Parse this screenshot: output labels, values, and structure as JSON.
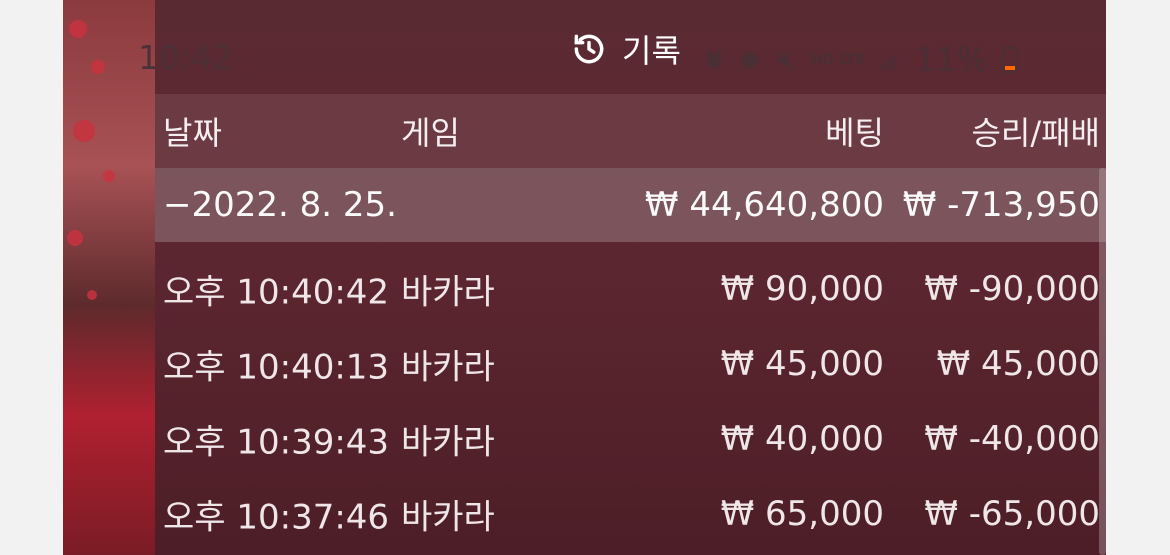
{
  "status_bar": {
    "time": "10:42",
    "network": "HD LTE",
    "battery": "11%"
  },
  "header": {
    "title": "기록",
    "icon": "history-icon"
  },
  "table": {
    "columns": {
      "date": "날짜",
      "game": "게임",
      "bet": "베팅",
      "win_loss": "승리/패배"
    },
    "summary": {
      "date": "−2022. 8. 25.",
      "bet": "₩ 44,640,800",
      "win_loss": "₩ -713,950"
    },
    "rows": [
      {
        "time": "오후 10:40:42",
        "game": "바카라",
        "bet": "₩ 90,000",
        "win_loss": "₩ -90,000"
      },
      {
        "time": "오후 10:40:13",
        "game": "바카라",
        "bet": "₩ 45,000",
        "win_loss": "₩ 45,000"
      },
      {
        "time": "오후 10:39:43",
        "game": "바카라",
        "bet": "₩ 40,000",
        "win_loss": "₩ -40,000"
      },
      {
        "time": "오후 10:37:46",
        "game": "바카라",
        "bet": "₩ 65,000",
        "win_loss": "₩ -65,000"
      }
    ]
  },
  "colors": {
    "panel": "#5a2a33",
    "battery_low": "#ff6a00"
  }
}
